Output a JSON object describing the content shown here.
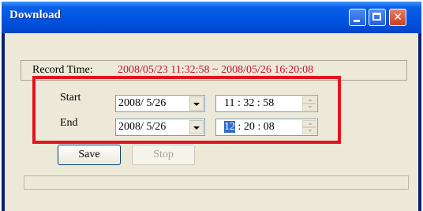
{
  "window": {
    "title": "Download",
    "controls": [
      "minimize-icon",
      "maximize-icon",
      "close-icon"
    ]
  },
  "record": {
    "label": "Record Time:",
    "value": "2008/05/23 11:32:58 ~ 2008/05/26 16:20:08"
  },
  "start": {
    "label": "Start",
    "date": "2008/ 5/26",
    "time_parts": [
      "11",
      ":",
      "32",
      ":",
      "58"
    ]
  },
  "end": {
    "label": "End",
    "date": "2008/ 5/26",
    "time_parts": [
      "12",
      ":",
      "20",
      ":",
      "08"
    ],
    "selected_part": "12"
  },
  "buttons": {
    "save": "Save",
    "stop": "Stop"
  },
  "progress": {
    "value": 0
  },
  "colors": {
    "highlight": "#e5131e",
    "record_value": "#c8102e",
    "selection": "#316ac5"
  }
}
